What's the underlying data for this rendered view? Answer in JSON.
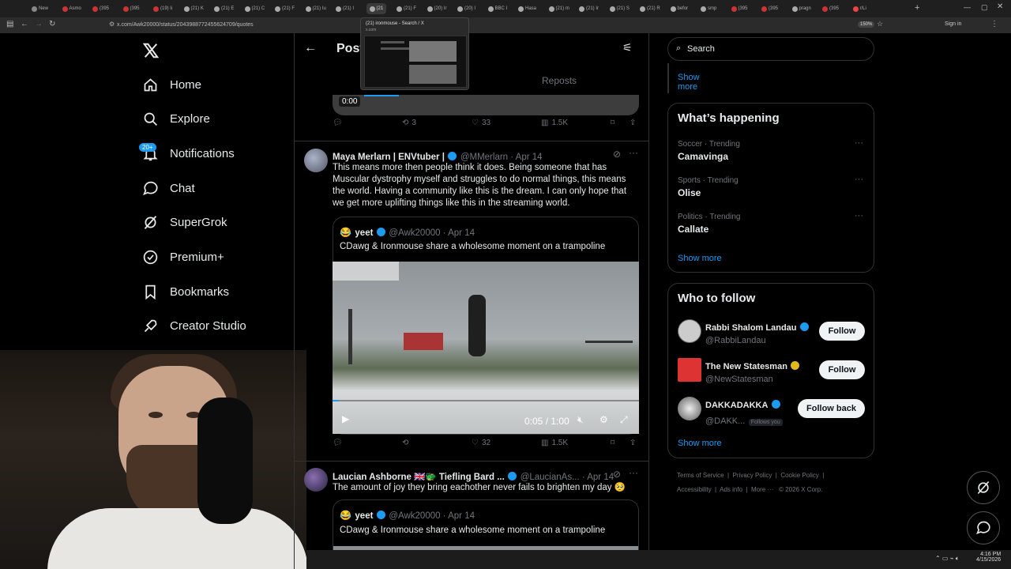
{
  "browser": {
    "tabs": [
      "New",
      "Asmo",
      "(395",
      "(395",
      "(19) li",
      "(21) K",
      "(21) E",
      "(21) C",
      "(21) F",
      "(21) Iu",
      "(21) I",
      "(21",
      "(21) F",
      "(20) Ir",
      "(20) I",
      "BBC I",
      "Hasa",
      "(21) m",
      "(21) Ir",
      "(21) S",
      "(21) R",
      "befor",
      "smp",
      "(395",
      "(395",
      "pragn",
      "(395",
      "r/Li"
    ],
    "url": "x.com/Awk20000/status/2043988772455624709/quotes",
    "zoom": "150%",
    "signin": "Sign in",
    "preview_title": "(21) ironmouse - Search / X",
    "preview_url": "x.com"
  },
  "nav": {
    "items": [
      "Home",
      "Explore",
      "Notifications",
      "Chat",
      "SuperGrok",
      "Premium+",
      "Bookmarks",
      "Creator Studio"
    ],
    "badge": "20+"
  },
  "header": {
    "title": "Post",
    "tab_reposts": "Reposts"
  },
  "top_video": {
    "time": "0:00"
  },
  "top_actions": {
    "retweets": "3",
    "likes": "33",
    "views": "1.5K"
  },
  "post1": {
    "name": "Maya Merlarn | ENVtuber |",
    "handle": "@MMerlarn · Apr 14",
    "text": "This means more then people think it does.  Being someone that has Muscular dystrophy myself and struggles to do normal things, this means the world.  Having a community like this is the dream.  I can only hope that we get more uplifting things like this in the streaming world.",
    "quote": {
      "emoji": "😂",
      "name": "yeet",
      "handle": "@Awk20000 · Apr 14",
      "text": "CDawg & Ironmouse share a wholesome moment on a trampoline"
    },
    "video": {
      "time": "0:05 / 1:00"
    },
    "actions": {
      "retweets": "",
      "likes": "32",
      "views": "1.5K"
    }
  },
  "post2": {
    "name": "Laucian Ashborne 🇬🇧🐲 Tiefling Bard ...",
    "handle": "@LaucianAs... · Apr 14",
    "text": "The amount of joy they bring eachother never fails to brighten my day 🥺",
    "quote": {
      "emoji": "😂",
      "name": "yeet",
      "handle": "@Awk20000 · Apr 14",
      "text": "CDawg & Ironmouse share a wholesome moment on a trampoline"
    }
  },
  "right": {
    "search_placeholder": "Search",
    "show_more_top": "Show more",
    "happening": {
      "title": "What’s happening",
      "trends": [
        {
          "meta": "Soccer · Trending",
          "name": "Camavinga"
        },
        {
          "meta": "Sports · Trending",
          "name": "Olise"
        },
        {
          "meta": "Politics · Trending",
          "name": "Callate"
        }
      ],
      "show_more": "Show more"
    },
    "follow": {
      "title": "Who to follow",
      "people": [
        {
          "name": "Rabbi Shalom Landau",
          "handle": "@RabbiLandau",
          "button": "Follow"
        },
        {
          "name": "The New Statesman",
          "handle": "@NewStatesman",
          "button": "Follow"
        },
        {
          "name": "DAKKADAKKA",
          "handle": "@DAKK...",
          "extra": "Follows you",
          "button": "Follow back"
        }
      ],
      "show_more": "Show more"
    },
    "footer": [
      "Terms of Service",
      "Privacy Policy",
      "Cookie Policy",
      "Accessibility",
      "Ads info",
      "More ···",
      "© 2026 X Corp."
    ]
  },
  "clock": {
    "time": "4:16 PM",
    "date": "4/15/2026"
  },
  "colors": {
    "accent": "#1d9bf0",
    "background": "#000000",
    "text": "#e7e9ea",
    "muted": "#71767b"
  }
}
